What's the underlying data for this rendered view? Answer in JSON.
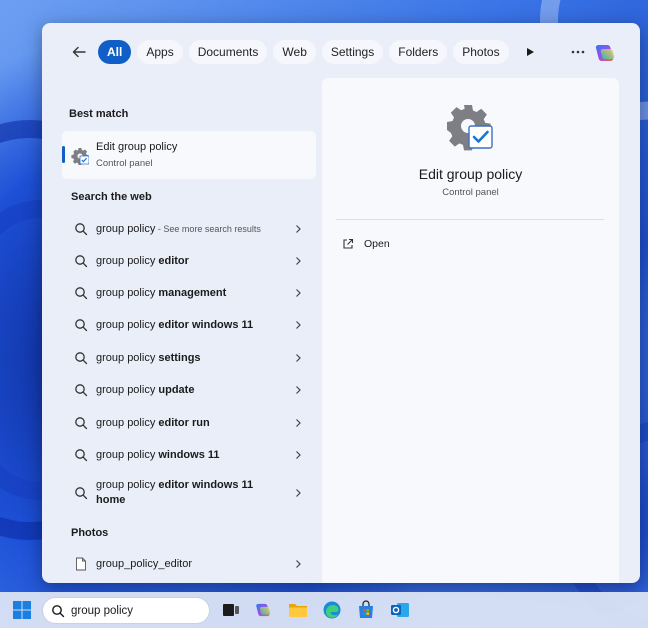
{
  "search_panel": {
    "filters": [
      {
        "label": "All",
        "active": true
      },
      {
        "label": "Apps",
        "active": false
      },
      {
        "label": "Documents",
        "active": false
      },
      {
        "label": "Web",
        "active": false
      },
      {
        "label": "Settings",
        "active": false
      },
      {
        "label": "Folders",
        "active": false
      },
      {
        "label": "Photos",
        "active": false
      }
    ],
    "icons": {
      "back": "arrow-left-icon",
      "play": "play-icon",
      "more": "more-icon",
      "copilot": "copilot-icon"
    }
  },
  "best_match": {
    "section_label": "Best match",
    "title": "Edit group policy",
    "subtitle": "Control panel",
    "icon": "gear-check-icon"
  },
  "web_section": {
    "section_label": "Search the web",
    "items": [
      {
        "query": "group policy",
        "bold_suffix": "",
        "hint": " - See more search results"
      },
      {
        "query": "group policy ",
        "bold_suffix": "editor",
        "hint": ""
      },
      {
        "query": "group policy ",
        "bold_suffix": "management",
        "hint": ""
      },
      {
        "query": "group policy ",
        "bold_suffix": "editor windows 11",
        "hint": ""
      },
      {
        "query": "group policy ",
        "bold_suffix": "settings",
        "hint": ""
      },
      {
        "query": "group policy ",
        "bold_suffix": "update",
        "hint": ""
      },
      {
        "query": "group policy ",
        "bold_suffix": "editor run",
        "hint": ""
      },
      {
        "query": "group policy ",
        "bold_suffix": "windows 11",
        "hint": ""
      },
      {
        "query": "group policy ",
        "bold_suffix": "editor windows 11 home",
        "hint": ""
      }
    ]
  },
  "photos_section": {
    "section_label": "Photos",
    "items": [
      {
        "name": "group_policy_editor",
        "icon": "file-icon"
      }
    ]
  },
  "preview": {
    "title": "Edit group policy",
    "subtitle": "Control panel",
    "action_open": "Open"
  },
  "taskbar": {
    "search_value": "group policy",
    "apps": [
      "start-icon",
      "task-view-icon",
      "copilot-icon",
      "file-explorer-icon",
      "edge-icon",
      "store-icon",
      "outlook-icon"
    ]
  },
  "colors": {
    "accent": "#0f5fc6",
    "panel": "#e9eef8",
    "preview": "#f8f9fc"
  }
}
